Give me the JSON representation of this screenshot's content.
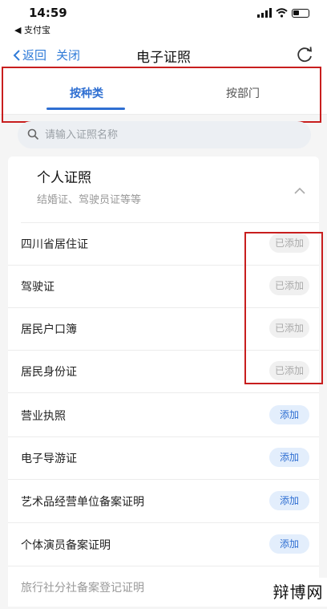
{
  "status": {
    "time": "14:59",
    "back_app": "◀ 支付宝"
  },
  "nav": {
    "back_label": "返回",
    "close_label": "关闭",
    "title": "电子证照"
  },
  "tabs": [
    {
      "label": "按种类",
      "active": true
    },
    {
      "label": "按部门",
      "active": false
    }
  ],
  "search": {
    "placeholder": "请输入证照名称",
    "value": ""
  },
  "section": {
    "title": "个人证照",
    "subtitle": "结婚证、驾驶员证等等"
  },
  "items": [
    {
      "label": "四川省居住证",
      "action": "已添加",
      "added": true
    },
    {
      "label": "驾驶证",
      "action": "已添加",
      "added": true
    },
    {
      "label": "居民户口簿",
      "action": "已添加",
      "added": true
    },
    {
      "label": "居民身份证",
      "action": "已添加",
      "added": true
    },
    {
      "label": "营业执照",
      "action": "添加",
      "added": false
    },
    {
      "label": "电子导游证",
      "action": "添加",
      "added": false
    },
    {
      "label": "艺术品经营单位备案证明",
      "action": "添加",
      "added": false
    },
    {
      "label": "个体演员备案证明",
      "action": "添加",
      "added": false
    },
    {
      "label": "旅行社分社备案登记证明",
      "action": "",
      "added": false
    }
  ],
  "watermark": "辩博网",
  "colors": {
    "accent": "#2f6fd2",
    "annotation_red": "#c81e1e"
  }
}
